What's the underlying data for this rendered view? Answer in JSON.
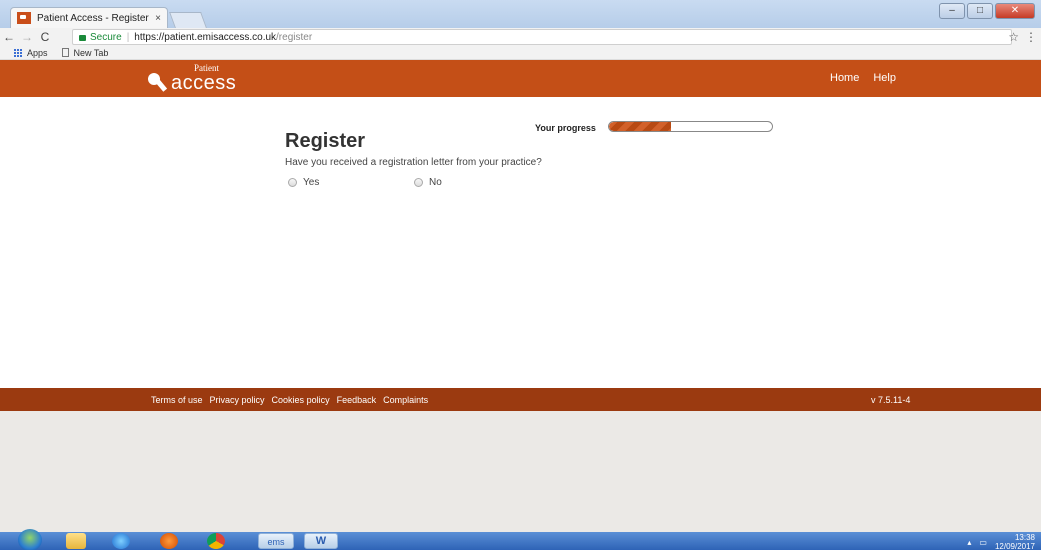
{
  "browser": {
    "tab_title": "Patient Access - Register",
    "tab_close": "×",
    "url_secure_label": "Secure",
    "url_separator": "|",
    "url_host": "https://patient.emisaccess.co.uk",
    "url_path": "/register",
    "bookmarks": [
      "Apps",
      "New Tab"
    ]
  },
  "site": {
    "logo_small": "Patient",
    "logo_big": "access",
    "nav": [
      "Home",
      "Help"
    ]
  },
  "progress": {
    "label": "Your progress",
    "fraction": 0.38
  },
  "main": {
    "title": "Register",
    "question": "Have you received a registration letter from your practice?",
    "options": [
      "Yes",
      "No"
    ]
  },
  "footer": {
    "links": [
      "Terms of use",
      "Privacy policy",
      "Cookies policy",
      "Feedback",
      "Complaints"
    ],
    "version": "v 7.5.11-4"
  },
  "taskbar": {
    "ems_label": "ems",
    "word_label": "W",
    "time": "13:38",
    "date": "12/09/2017"
  },
  "colors": {
    "brand": "#c44f17",
    "footer": "#9b3a10"
  }
}
